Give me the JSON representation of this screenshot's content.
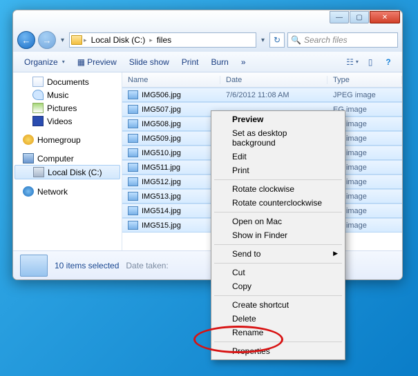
{
  "breadcrumb": {
    "drive": "Local Disk (C:)",
    "folder": "files"
  },
  "search": {
    "placeholder": "Search files"
  },
  "toolbar": {
    "organize": "Organize",
    "preview": "Preview",
    "slideshow": "Slide show",
    "print": "Print",
    "burn": "Burn",
    "more": "»"
  },
  "sidebar": {
    "documents": "Documents",
    "music": "Music",
    "pictures": "Pictures",
    "videos": "Videos",
    "homegroup": "Homegroup",
    "computer": "Computer",
    "localdisk": "Local Disk (C:)",
    "network": "Network"
  },
  "columns": {
    "name": "Name",
    "date": "Date",
    "type": "Type"
  },
  "files": [
    {
      "name": "IMG506.jpg",
      "date": "7/6/2012 11:08 AM",
      "type": "JPEG image"
    },
    {
      "name": "IMG507.jpg",
      "date": "",
      "type": "EG image"
    },
    {
      "name": "IMG508.jpg",
      "date": "",
      "type": "EG image"
    },
    {
      "name": "IMG509.jpg",
      "date": "",
      "type": "EG image"
    },
    {
      "name": "IMG510.jpg",
      "date": "",
      "type": "EG image"
    },
    {
      "name": "IMG511.jpg",
      "date": "",
      "type": "EG image"
    },
    {
      "name": "IMG512.jpg",
      "date": "",
      "type": "EG image"
    },
    {
      "name": "IMG513.jpg",
      "date": "",
      "type": "EG image"
    },
    {
      "name": "IMG514.jpg",
      "date": "",
      "type": "EG image"
    },
    {
      "name": "IMG515.jpg",
      "date": "",
      "type": "EG image"
    }
  ],
  "status": {
    "count": "10 items selected",
    "datetaken": "Date taken:"
  },
  "ctx": {
    "preview": "Preview",
    "setbg": "Set as desktop background",
    "edit": "Edit",
    "print": "Print",
    "rotcw": "Rotate clockwise",
    "rotccw": "Rotate counterclockwise",
    "openmac": "Open on Mac",
    "showfinder": "Show in Finder",
    "sendto": "Send to",
    "cut": "Cut",
    "copy": "Copy",
    "shortcut": "Create shortcut",
    "delete": "Delete",
    "rename": "Rename",
    "properties": "Properties"
  }
}
